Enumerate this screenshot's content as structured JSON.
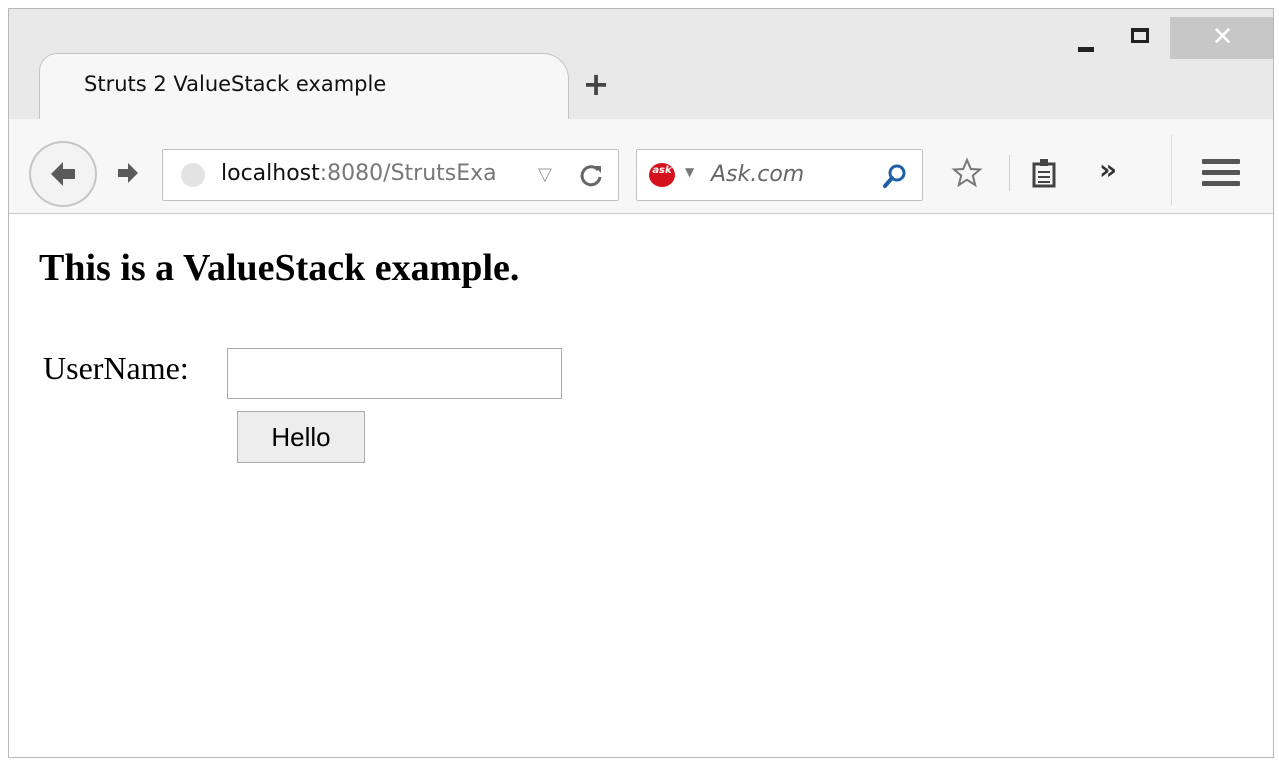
{
  "window": {
    "tab_title": "Struts 2 ValueStack example",
    "new_tab_label": "+",
    "close_label": "✕"
  },
  "toolbar": {
    "url_host": "localhost",
    "url_rest": ":8080/StrutsExa",
    "search_engine_logo": "ask",
    "search_placeholder": "Ask.com",
    "overflow_label": "»",
    "icons": [
      "back-arrow-icon",
      "forward-arrow-icon",
      "globe-icon",
      "dropdown-icon",
      "reload-icon",
      "search-icon",
      "star-icon",
      "reading-list-icon",
      "hamburger-menu-icon"
    ]
  },
  "page": {
    "heading": "This is a ValueStack example.",
    "username_label": "UserName:",
    "username_value": "",
    "submit_label": "Hello"
  },
  "colors": {
    "chrome_bg": "#e9e9e9",
    "toolbar_bg": "#f7f7f7",
    "close_button": "#c7c7c7",
    "ask_brand": "#d4121e",
    "search_icon": "#1f5fa8"
  }
}
